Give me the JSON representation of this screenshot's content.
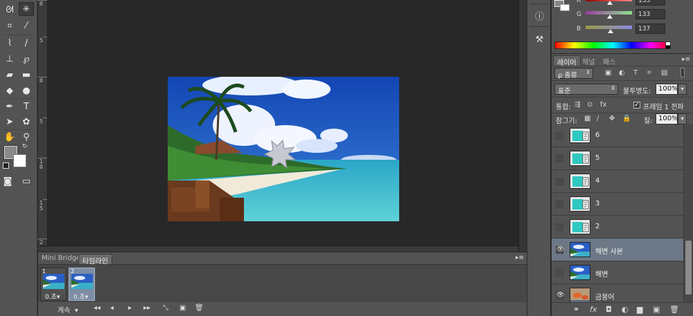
{
  "colors": {
    "panel_bg": "#535353",
    "canvas_bg": "#282828",
    "selection": "#6c7886"
  },
  "tools": {
    "items": [
      {
        "name": "lasso-icon",
        "glyph": "ᘛ"
      },
      {
        "name": "magic-wand-icon",
        "glyph": "✳"
      },
      {
        "name": "crop-icon",
        "glyph": "⌗"
      },
      {
        "name": "eyedropper-icon",
        "glyph": "⁄"
      },
      {
        "name": "healing-brush-icon",
        "glyph": "⌇"
      },
      {
        "name": "brush-icon",
        "glyph": "∕"
      },
      {
        "name": "clone-stamp-icon",
        "glyph": "⊥"
      },
      {
        "name": "history-brush-icon",
        "glyph": "℘"
      },
      {
        "name": "eraser-icon",
        "glyph": "▰"
      },
      {
        "name": "gradient-icon",
        "glyph": "▬"
      },
      {
        "name": "blur-icon",
        "glyph": "◆"
      },
      {
        "name": "dodge-icon",
        "glyph": "●"
      },
      {
        "name": "pen-icon",
        "glyph": "✒"
      },
      {
        "name": "type-icon",
        "glyph": "T"
      },
      {
        "name": "path-selection-icon",
        "glyph": "➤"
      },
      {
        "name": "custom-shape-icon",
        "glyph": "✿"
      },
      {
        "name": "hand-icon",
        "glyph": "✋"
      },
      {
        "name": "zoom-icon",
        "glyph": "⚲"
      }
    ],
    "quick_mask_glyph": "◙",
    "screen_mode_glyph": "▭",
    "swap_glyph": "↻"
  },
  "ruler": {
    "labels": [
      "0",
      "5",
      "0",
      "5",
      "1\n0",
      "1\n5",
      "2"
    ]
  },
  "timeline": {
    "tabs": [
      "Mini Bridge",
      "타임라인"
    ],
    "menu_glyph": "▸≡",
    "frames": [
      {
        "number": "1",
        "delay": "0.초"
      },
      {
        "number": "2",
        "delay": "0.초"
      }
    ],
    "delay_arrow": "▾",
    "loop_label": "계속",
    "loop_arrow": "▾",
    "controls": [
      "◂◂",
      "◂",
      "▸",
      "▸▸",
      "⤡",
      "▣",
      "🗑"
    ]
  },
  "dock": {
    "items": [
      {
        "name": "info-icon",
        "glyph": "ⓘ"
      },
      {
        "name": "tool-presets-icon",
        "glyph": "⚒"
      }
    ]
  },
  "color_panel": {
    "channels": [
      {
        "label": "R",
        "value": "133",
        "fill": 0.52
      },
      {
        "label": "G",
        "value": "133",
        "fill": 0.52
      },
      {
        "label": "B",
        "value": "137",
        "fill": 0.54
      }
    ]
  },
  "layers": {
    "tabs": [
      "레이어",
      "채널",
      "패스"
    ],
    "menu_glyph": "▸≡",
    "filter_label": "ρ 종류",
    "filter_arrow": "⇕",
    "blend_mode": "표준",
    "blend_arrow": "⇕",
    "opacity_label": "불투명도:",
    "opacity_value": "100%",
    "unify_label": "통합:",
    "propagate_label": "프레임 1 전파",
    "propagate_checked": "✓",
    "lock_label": "잠그기:",
    "fill_label": "칠:",
    "fill_value": "100%",
    "dropdown_arrow": "▾",
    "items": [
      {
        "name": "6",
        "visible": "",
        "kind": "frames"
      },
      {
        "name": "5",
        "visible": "",
        "kind": "frames"
      },
      {
        "name": "4",
        "visible": "",
        "kind": "frames"
      },
      {
        "name": "3",
        "visible": "",
        "kind": "frames"
      },
      {
        "name": "2",
        "visible": "",
        "kind": "frames"
      },
      {
        "name": "해변 사본",
        "visible": "👁",
        "kind": "beach"
      },
      {
        "name": "해변",
        "visible": "",
        "kind": "beach"
      },
      {
        "name": "금붕어",
        "visible": "👁",
        "kind": "fish"
      }
    ],
    "footer": [
      {
        "name": "link-icon",
        "glyph": "⚭"
      },
      {
        "name": "fx-icon",
        "glyph": "fx"
      },
      {
        "name": "mask-icon",
        "glyph": "◘"
      },
      {
        "name": "adjustment-icon",
        "glyph": "◐"
      },
      {
        "name": "group-icon",
        "glyph": "▆"
      },
      {
        "name": "new-layer-icon",
        "glyph": "▣"
      },
      {
        "name": "delete-icon",
        "glyph": "🗑"
      }
    ]
  }
}
